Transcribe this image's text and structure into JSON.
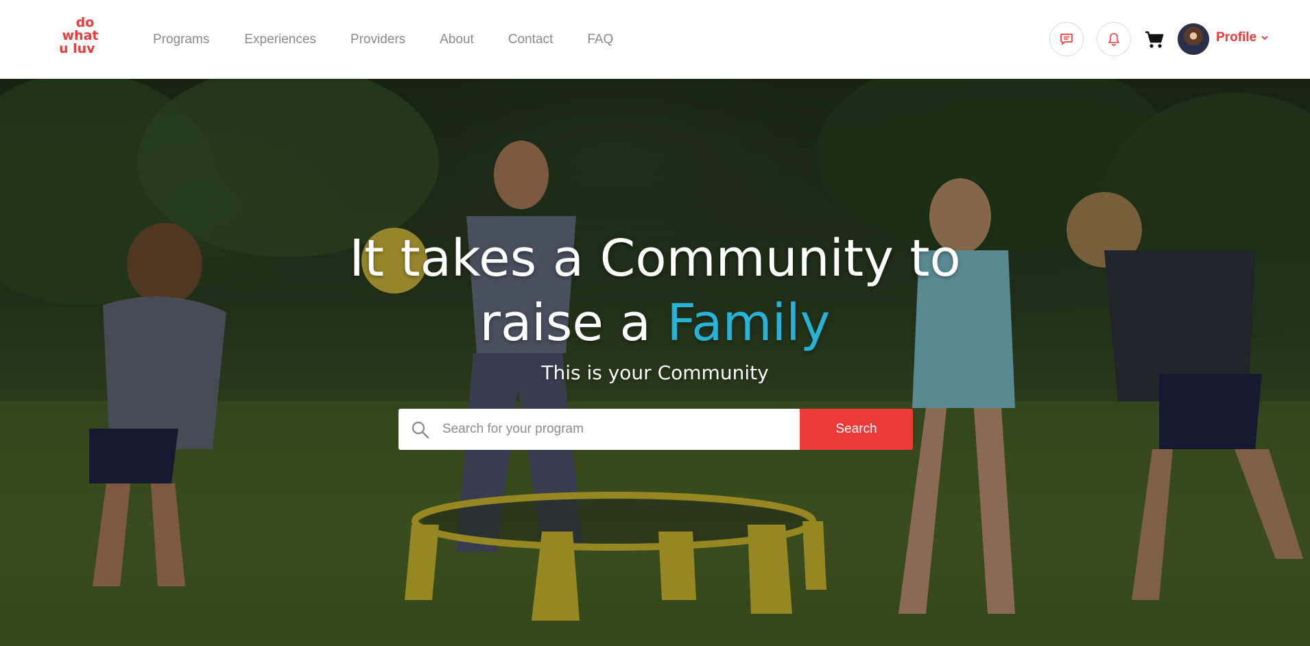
{
  "brand": {
    "logo_lines": [
      "do",
      "what",
      "u luv"
    ],
    "accent_color": "#ef3a3a"
  },
  "nav": {
    "items": [
      {
        "label": "Programs"
      },
      {
        "label": "Experiences"
      },
      {
        "label": "Providers"
      },
      {
        "label": "About"
      },
      {
        "label": "Contact"
      },
      {
        "label": "FAQ"
      }
    ]
  },
  "header_actions": {
    "chat_icon": "chat-icon",
    "bell_icon": "bell-icon",
    "cart_icon": "cart-icon",
    "profile_label": "Profile"
  },
  "hero": {
    "headline_part1": "It takes a Community to",
    "headline_part2": "raise a",
    "headline_accent": "Family",
    "accent_color": "#27b2d6",
    "subheadline": "This is your Community",
    "search_placeholder": "Search for your program",
    "search_value": "",
    "search_button": "Search"
  }
}
